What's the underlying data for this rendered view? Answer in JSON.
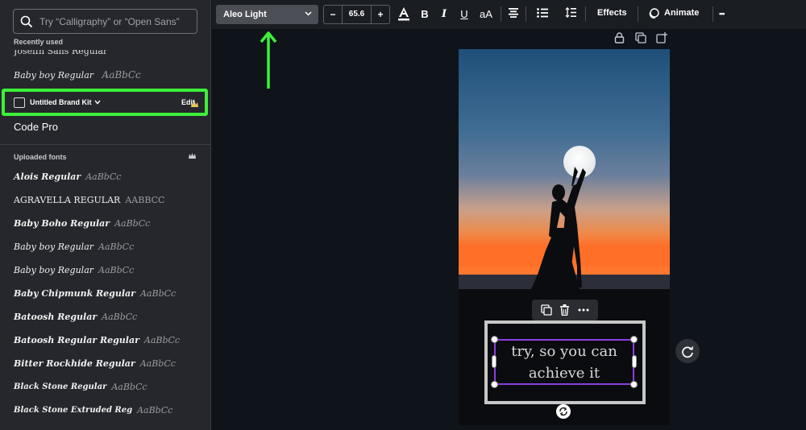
{
  "sidebar": {
    "search_placeholder": "Try “Calligraphy” or “Open Sans”",
    "recently_used_label": "Recently used",
    "recent_fonts": [
      {
        "name": "Joseffn Sans Regular",
        "sample": ""
      },
      {
        "name": "Baby boy Regular",
        "sample": "AaBbCc"
      }
    ],
    "brand_kit": {
      "label": "Untitled Brand Kit",
      "edit_label": "Edit"
    },
    "brand_font": "Code Pro",
    "uploaded_label": "Uploaded fonts",
    "uploaded_fonts": [
      {
        "name": "Alois Regular",
        "sample": "AaBbCc"
      },
      {
        "name": "AGRAVELLA REGULAR",
        "sample": "AABBCC"
      },
      {
        "name": "Baby Boho Regular",
        "sample": "AaBbCc"
      },
      {
        "name": "Baby boy Regular",
        "sample": "AaBbCc"
      },
      {
        "name": "Baby boy Regular",
        "sample": "AaBbCc"
      },
      {
        "name": "Baby Chipmunk Regular",
        "sample": "AaBbCc"
      },
      {
        "name": "Batoosh Regular",
        "sample": "AaBbCc"
      },
      {
        "name": "Batoosh Regular Regular",
        "sample": "AaBbCc"
      },
      {
        "name": "Bitter Rockhide Regular",
        "sample": "AaBbCc"
      },
      {
        "name": "Black Stone Regular",
        "sample": "AaBbCc"
      },
      {
        "name": "Black Stone Extruded Reg",
        "sample": "AaBbCc"
      }
    ]
  },
  "toolbar": {
    "font_name": "Aleo Light",
    "font_size": "65.6",
    "minus": "−",
    "plus": "+",
    "bold": "B",
    "italic": "I",
    "underline": "U",
    "case": "aA",
    "effects_label": "Effects",
    "animate_label": "Animate",
    "more": "•••"
  },
  "canvas": {
    "text_content": "try, so you can achieve it",
    "text_line1": "try, so you can",
    "text_line2": "achieve it"
  },
  "colors": {
    "highlight": "#3ef03a",
    "selection": "#8b3fe0",
    "sidebar_bg": "#25272c"
  }
}
